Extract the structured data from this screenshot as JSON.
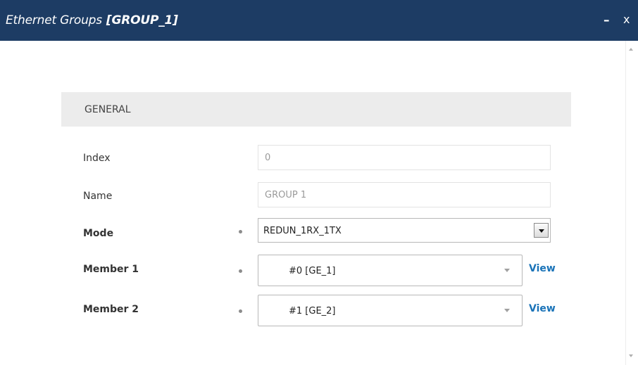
{
  "window": {
    "title": "Ethernet Groups",
    "title_suffix": "[GROUP_1]",
    "minimize_glyph": "–",
    "close_glyph": "x"
  },
  "section": {
    "title": "GENERAL"
  },
  "fields": {
    "index": {
      "label": "Index",
      "value": "0"
    },
    "name": {
      "label": "Name",
      "value": "GROUP 1"
    },
    "mode": {
      "label": "Mode",
      "value": "REDUN_1RX_1TX"
    },
    "member1": {
      "label": "Member 1",
      "value": "#0 [GE_1]",
      "link": "View"
    },
    "member2": {
      "label": "Member 2",
      "value": "#1 [GE_2]",
      "link": "View"
    }
  },
  "colors": {
    "titlebar": "#1d3c64",
    "section_bg": "#ececec",
    "link": "#1a73b8"
  }
}
